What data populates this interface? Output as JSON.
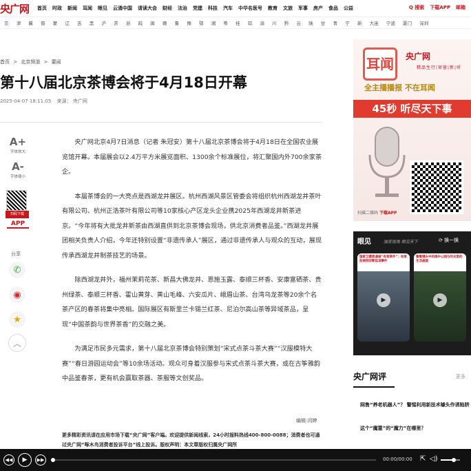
{
  "nav": {
    "logo": "央广网",
    "links": [
      "首页",
      "时政",
      "新闻",
      "耳闻",
      "眼见",
      "云涌中国",
      "请读大会",
      "财经",
      "法治",
      "党建",
      "科技",
      "汽车",
      "中华名医号",
      "教育",
      "文旅",
      "军事",
      "房产",
      "食品",
      "公益"
    ],
    "search": "Q 搜索",
    "download": "下载APP",
    "mail": "邮箱"
  },
  "regions": [
    "京",
    "津",
    "冀",
    "晋",
    "蒙",
    "辽",
    "吉",
    "黑",
    "沪",
    "苏",
    "浙",
    "皖",
    "闽",
    "赣",
    "鲁",
    "豫",
    "鄂",
    "湘",
    "粤",
    "桂",
    "琼",
    "渝",
    "川",
    "黔",
    "云",
    "陕",
    "甘",
    "青",
    "宁",
    "新",
    "大连",
    "宁波",
    "厦门",
    "深圳"
  ],
  "breadcrumb": [
    "首页",
    ">",
    "北京频道",
    ">",
    "要闻"
  ],
  "article": {
    "title": "第十八届北京茶博会将于4月18日开幕",
    "date": "2025-04-07 18:11:05",
    "source": "来源：  央广网",
    "paragraphs": [
      "央广网北京4月7日消息（记者 朱冠安）第十八届北京茶博会将于4月18日在全国农业展览馆开幕。本届展会以2.4万平方米展览面积、1300余个标准展位，将汇聚国内外700余家茶企。",
      "本届茶博会的一大亮点是西湖龙井展区。杭州西湖风景区管委会将组织杭州西湖龙井茶叶有限公司、杭州正浩茶叶有限公司等10家核心产区龙头企业携2025年西湖龙井新茶进京。“今年将有大批龙井新茶由西湖直供到北京茶博会现场，供北京消费者品鉴。”西湖龙井展团相关负责人介绍，今年还特别设置“非遗传承人”展区，通过非遗传承人与观众的互动，展现传承西湖龙井制茶技艺的场景。",
      "除西湖龙井外，福州茉莉花茶、新昌大佛龙井、恩施玉露、泰顺三杯香、安康富硒茶、贵州绿茶、泰顺三杯香、霍山黄芽、黄山毛峰、六安瓜片、峨眉山茶、台湾乌龙茶等20余个名茶产区的春茶将集中亮相。国际展区有斯里兰卡锡兰红茶、尼泊尔高山茶等异域茶品，呈现“中国茶韵与世界茶香”的交融之美。",
      "为满足市民多元需求，第十八届北京茶博会特别策划“宋式点茶斗茶大赛”“汉服模特大赛”“春日游园运动会”等10余场活动。观众可身着汉服参与宋式点茶斗茶大赛，或在古筝雅韵中品鉴春茶，更有机会赢取茶器、茶服等文创奖品。"
    ],
    "editor": "编辑:闫婷",
    "notice": "更多精彩资讯请在应用市场下载“央广网”客户端。欢迎提供新闻线索，24小时报料热线400-800-0088；消费者也可通过央广网“啄木鸟消费者投诉平台”线上投诉。版权声明：本文章版权归属央广网所"
  },
  "tools": {
    "font_up_icon": "A+",
    "font_up": "字体放大",
    "font_down_icon": "A-",
    "font_down": "字体缩小",
    "qr_download": "扫码下载",
    "app_badge": "APP",
    "share": "分享",
    "wechat_icon": "wechat-icon",
    "weibo_icon": "weibo-icon",
    "star_icon": "star-icon",
    "up_glyph": "︿"
  },
  "ad": {
    "brand_mark": "耳闻",
    "brand": "央广网",
    "tags": "精品生行|官营|新|听",
    "slogan": "全主播播报  不在耳闻",
    "band": "45秒 听尽天下事",
    "scan_text": "扫描二维码",
    "scan_action": "下载APP"
  },
  "eye": {
    "title": "眼见",
    "subtitle": "独家视角 眼见天下",
    "swap": "换一换",
    "videos": [
      {
        "caption": "国家卫健委通报“有某某件”：有某些病例诊断延误事件"
      },
      {
        "caption": "看看镜头中的雨中公园与时光里的生活画面"
      }
    ]
  },
  "commentary": {
    "title": "央广网评",
    "more": "更多",
    "items": [
      "网售“养老机器人”？ 警惕利用新技术噱头作诱陷阱",
      "这个“魔童”的“魔力”在哪里？"
    ]
  },
  "player": {
    "time": "00:00/00:00"
  },
  "colors": {
    "brand_red": "#c8161d"
  }
}
